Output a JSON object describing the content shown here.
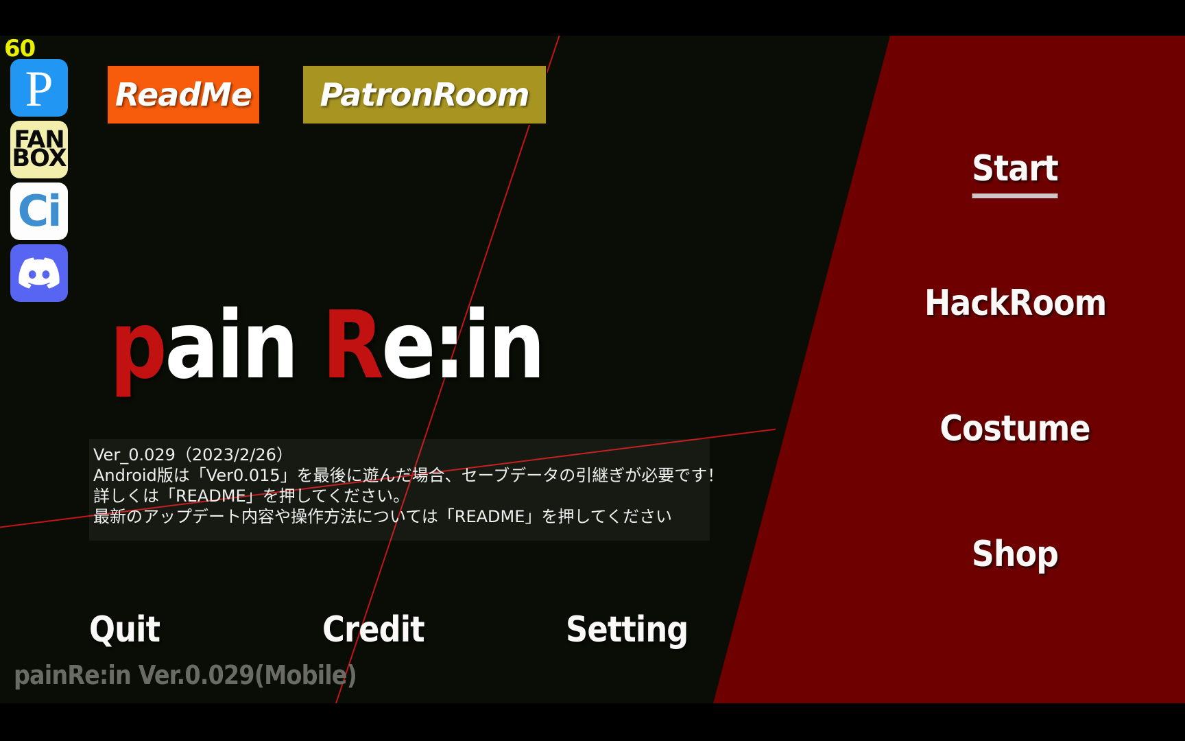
{
  "hud": {
    "fps": "60"
  },
  "socials": [
    {
      "name": "pixiv-icon",
      "glyph": "P",
      "label": "pixiv",
      "bg": "#2196f3"
    },
    {
      "name": "fanbox-icon",
      "line1": "FAN",
      "line2": "BOX",
      "label": "FANBOX",
      "bg": "#f3eeac"
    },
    {
      "name": "cien-icon",
      "glyph": "Ci",
      "label": "Ci-en",
      "bg": "#fdfdfd"
    },
    {
      "name": "discord-icon",
      "glyph": "",
      "label": "Discord",
      "bg": "#5865f2"
    }
  ],
  "links": {
    "readme": "ReadMe",
    "patronroom": "PatronRoom"
  },
  "title": {
    "part1": "p",
    "part2": "ain ",
    "part3": "R",
    "part4": "e:in",
    "full": "pain Re:in"
  },
  "notice": {
    "line1": "Ver_0.029（2023/2/26）",
    "line2": "Android版は「Ver0.015」を最後に遊んだ場合、セーブデータの引継ぎが必要です！",
    "line3": "詳しくは「README」を押してください。",
    "line4": "最新のアップデート内容や操作方法については「README」を押してください"
  },
  "menu_right": [
    {
      "label": "Start",
      "selected": true
    },
    {
      "label": "HackRoom",
      "selected": false
    },
    {
      "label": "Costume",
      "selected": false
    },
    {
      "label": "Shop",
      "selected": false
    }
  ],
  "menu_bottom": [
    {
      "label": "Quit"
    },
    {
      "label": "Credit"
    },
    {
      "label": "Setting"
    }
  ],
  "watermark": "painRe:in Ver.0.029(Mobile)",
  "colors": {
    "background": "#0a0d06",
    "accent_red": "#6e0000",
    "title_red": "#c21111",
    "readme_orange": "#f75c0c",
    "patron_olive": "#a89521",
    "fps_yellow": "#e8f000",
    "letterbox": "#000000"
  }
}
